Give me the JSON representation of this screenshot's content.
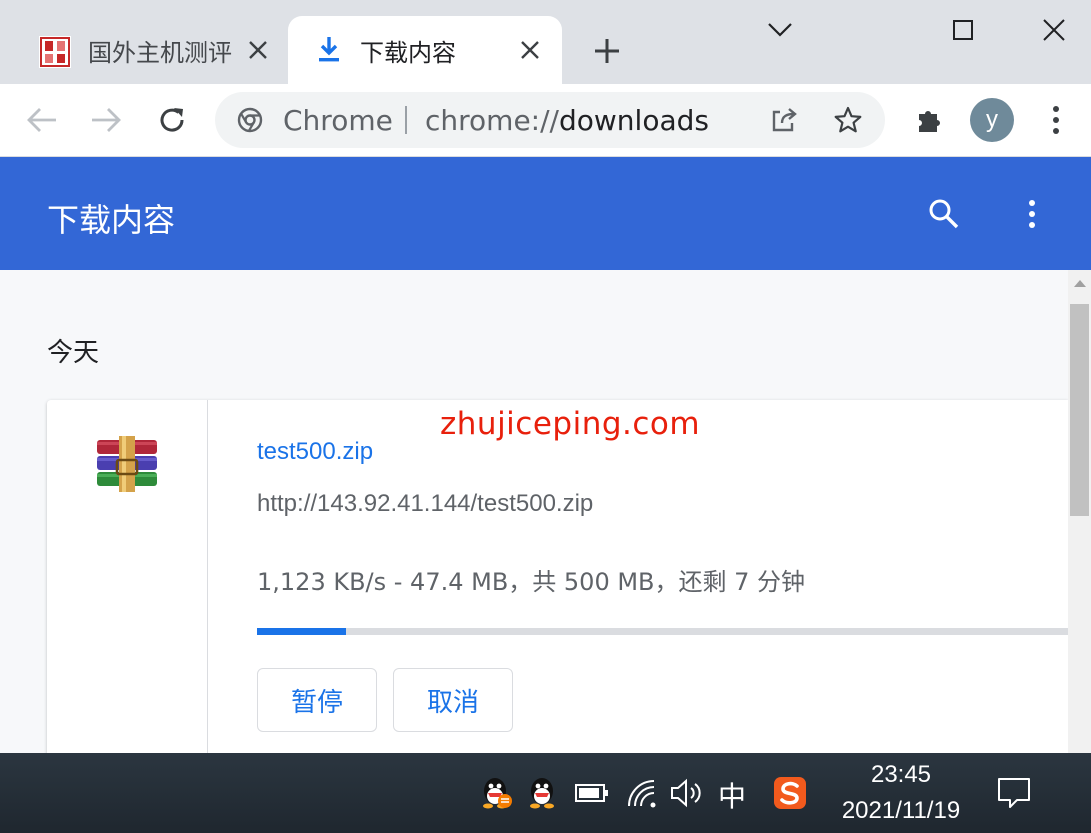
{
  "tabs": [
    {
      "title": "国外主机测评",
      "favicon": "site-logo-icon",
      "active": false
    },
    {
      "title": "下载内容",
      "favicon": "download-icon",
      "active": true
    }
  ],
  "omnibox": {
    "site_label": "Chrome",
    "url_scheme": "chrome://",
    "url_host": "downloads"
  },
  "profile": {
    "initial": "y"
  },
  "downloads_page": {
    "title": "下载内容",
    "date_group": "今天",
    "items": [
      {
        "file_name": "test500.zip",
        "url": "http://143.92.41.144/test500.zip",
        "status": "1,123 KB/s - 47.4 MB，共 500 MB，还剩 7 分钟",
        "progress_fraction": 0.11,
        "pause_label": "暂停",
        "cancel_label": "取消",
        "icon": "winrar-archive-icon"
      }
    ]
  },
  "watermark": "zhujiceping.com",
  "taskbar": {
    "ime": "中",
    "time": "23:45",
    "date": "2021/11/19"
  },
  "colors": {
    "header_blue": "#3367d6",
    "link_blue": "#1a73e8",
    "watermark_red": "#e8200c"
  }
}
